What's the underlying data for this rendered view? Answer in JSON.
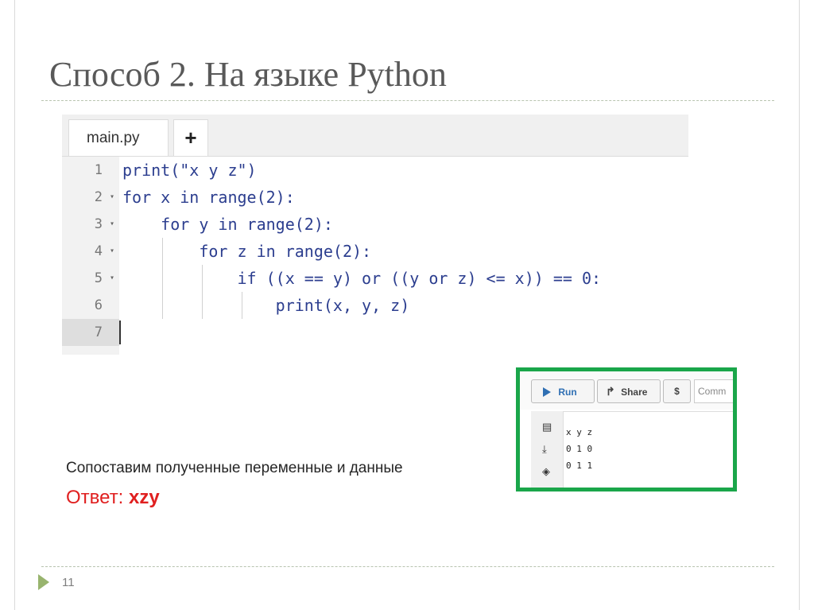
{
  "slide": {
    "title": "Способ 2. На языке Python",
    "caption": "Сопоставим полученные переменные и данные",
    "answer_label": "Ответ: ",
    "answer_value": "xzy",
    "page_number": "11"
  },
  "editor": {
    "tab_label": "main.py",
    "add_tab_label": "+",
    "line_numbers": [
      "1",
      "2",
      "3",
      "4",
      "5",
      "6",
      "7"
    ],
    "fold_marker": "▾",
    "lines": [
      "print(\"x y z\")",
      "for x in range(2):",
      "    for y in range(2):",
      "        for z in range(2):",
      "            if ((x == y) or ((y or z) <= x)) == 0:",
      "                print(x, y, z)",
      ""
    ]
  },
  "output_panel": {
    "run_label": "Run",
    "share_label": "Share",
    "dollar_label": "$",
    "command_placeholder": "Comm",
    "output_text": "x y z\n0 1 0\n0 1 1",
    "icons": [
      "copy-icon",
      "download-icon",
      "eraser-icon"
    ],
    "accent_color": "#1aa64a"
  }
}
